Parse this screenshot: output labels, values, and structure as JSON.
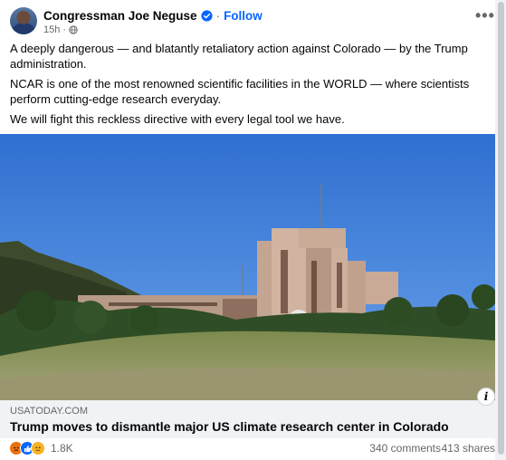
{
  "post": {
    "author": "Congressman Joe Neguse",
    "separator": "·",
    "follow_label": "Follow",
    "timestamp": "15h",
    "audience_icon": "globe-icon",
    "verified_icon": "verified-badge-icon",
    "paragraphs": [
      "A deeply dangerous — and blatantly retaliatory action against Colorado — by the Trump administration.",
      "NCAR is one of the most renowned scientific facilities in the WORLD — where scientists perform cutting-edge research everyday.",
      "We will fight this reckless directive with every legal tool we have."
    ]
  },
  "link_preview": {
    "domain": "USATODAY.COM",
    "headline": "Trump moves to dismantle major US climate research center in Colorado"
  },
  "engagement": {
    "reactions": [
      "angry-icon",
      "like-icon",
      "sad-icon"
    ],
    "reaction_count": "1.8K",
    "comments": "340 comments",
    "shares": "413 shares"
  },
  "colors": {
    "accent": "#0866ff",
    "secondary_text": "#65676b",
    "card_bg": "#f0f2f5"
  }
}
